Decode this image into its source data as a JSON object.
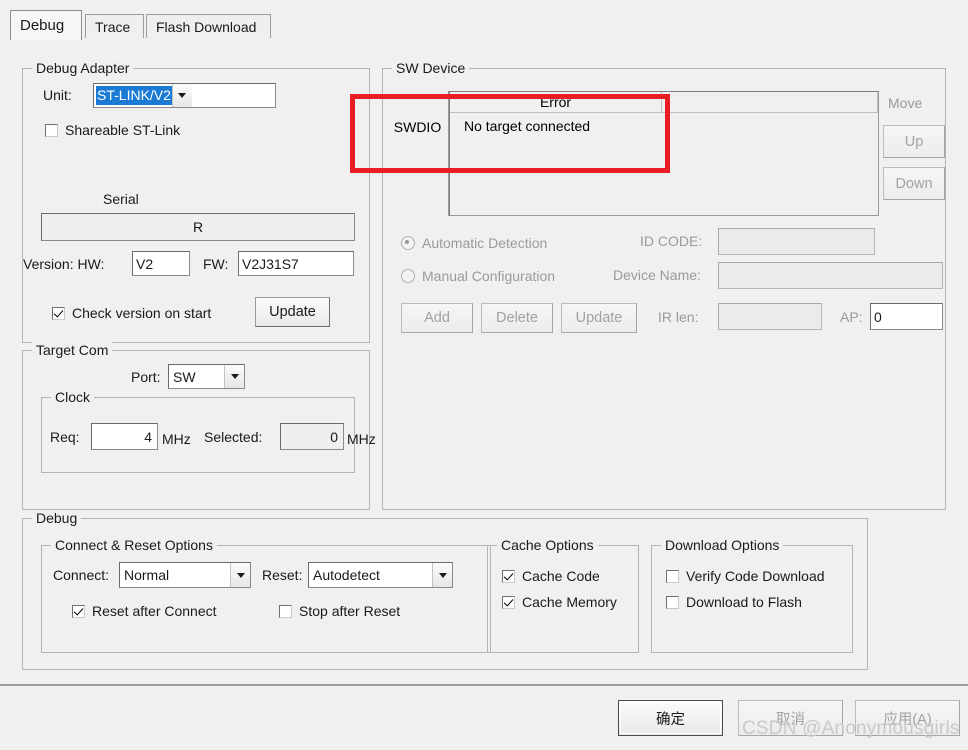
{
  "tabs": [
    {
      "label": "Debug",
      "active": true
    },
    {
      "label": "Trace",
      "active": false
    },
    {
      "label": "Flash Download",
      "active": false
    }
  ],
  "debug_adapter": {
    "title": "Debug Adapter",
    "unit_label": "Unit:",
    "unit_value": "ST-LINK/V2",
    "shareable_label": "Shareable ST-Link",
    "shareable_checked": false,
    "serial_label": "Serial",
    "serial_value": "R",
    "version_label": "Version: HW:",
    "hw_value": "V2",
    "fw_label": "FW:",
    "fw_value": "V2J31S7",
    "check_version_label": "Check version on start",
    "check_version_checked": true,
    "update_label": "Update"
  },
  "target_com": {
    "title": "Target Com",
    "port_label": "Port:",
    "port_value": "SW",
    "clock_title": "Clock",
    "req_label": "Req:",
    "req_value": "4",
    "req_unit": "MHz",
    "selected_label": "Selected:",
    "selected_value": "0",
    "selected_unit": "MHz"
  },
  "sw_device": {
    "title": "SW Device",
    "row_label": "SWDIO",
    "column_headers": [
      "Error",
      ""
    ],
    "rows": [
      [
        "No target connected",
        ""
      ]
    ],
    "move_label": "Move",
    "up_label": "Up",
    "down_label": "Down",
    "automatic_detection_label": "Automatic Detection",
    "automatic_detection_selected": true,
    "manual_configuration_label": "Manual Configuration",
    "manual_configuration_selected": false,
    "id_code_label": "ID CODE:",
    "id_code_value": "",
    "device_name_label": "Device Name:",
    "device_name_value": "",
    "ir_len_label": "IR len:",
    "ir_len_value": "",
    "ap_label": "AP:",
    "ap_value": "0",
    "add_label": "Add",
    "delete_label": "Delete",
    "update_label": "Update"
  },
  "debug_section": {
    "title": "Debug",
    "connect_reset": {
      "title": "Connect & Reset Options",
      "connect_label": "Connect:",
      "connect_value": "Normal",
      "reset_label": "Reset:",
      "reset_value": "Autodetect",
      "reset_after_connect_label": "Reset after Connect",
      "reset_after_connect_checked": true,
      "stop_after_reset_label": "Stop after Reset",
      "stop_after_reset_checked": false
    },
    "cache_options": {
      "title": "Cache Options",
      "cache_code_label": "Cache Code",
      "cache_code_checked": true,
      "cache_memory_label": "Cache Memory",
      "cache_memory_checked": true
    },
    "download_options": {
      "title": "Download Options",
      "verify_code_download_label": "Verify Code Download",
      "verify_code_download_checked": false,
      "download_to_flash_label": "Download to Flash",
      "download_to_flash_checked": false
    }
  },
  "footer": {
    "ok_label": "确定",
    "cancel_label": "取消",
    "apply_label": "应用(A)"
  },
  "annotation": {
    "highlight_color": "#ec1c24"
  },
  "watermark": {
    "text": "CSDN @Anonymousgirls"
  }
}
